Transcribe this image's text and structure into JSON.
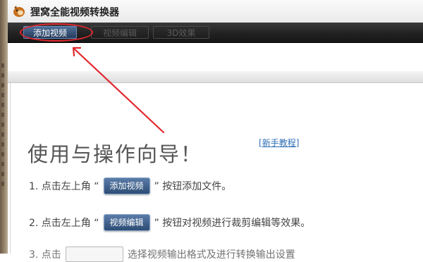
{
  "window": {
    "title": "狸窝全能视频转换器"
  },
  "toolbar": {
    "add_video": "添加视频",
    "video_edit": "视频编辑",
    "effect_3d": "3D效果"
  },
  "guide": {
    "heading": "使用与操作向导！",
    "tutorial_link": "新手教程",
    "step1": {
      "prefix": "1. 点击左上角 “",
      "button": "添加视频",
      "suffix": "” 按钮添加文件。"
    },
    "step2": {
      "prefix": "2. 点击左上角 “",
      "button": "视频编辑",
      "suffix": "” 按钮对视频进行裁剪编辑等效果。"
    },
    "step3": {
      "prefix": "3. 点击",
      "suffix": "选择视频输出格式及进行转换输出设置"
    }
  },
  "colors": {
    "annotation": "#e0282e",
    "toolbar": "#222222",
    "button": "#2c4c74"
  }
}
